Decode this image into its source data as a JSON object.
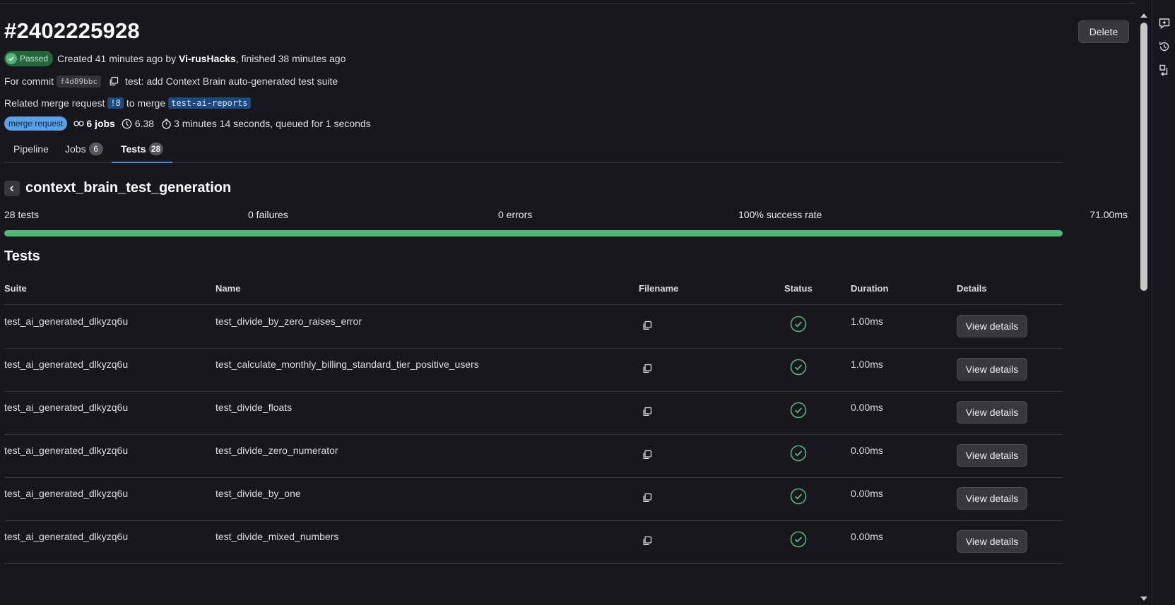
{
  "pipeline": {
    "title": "#2402225928",
    "delete_label": "Delete",
    "status_label": "Passed",
    "created_prefix": "Created 41 minutes ago by",
    "author": "Vi-rusHacks",
    "finished_text": ", finished 38 minutes ago",
    "commit_prefix": "For commit",
    "commit_sha": "f4d89bbc",
    "commit_message": "test: add Context Brain auto-generated test suite",
    "mr_prefix": "Related merge request",
    "mr_ref": "!8",
    "mr_to": "to merge",
    "branch": "test-ai-reports",
    "source_badge": "merge request",
    "jobs_count_label": "6 jobs",
    "score": "6.38",
    "duration_text": "3 minutes 14 seconds, queued for 1 seconds"
  },
  "tabs": [
    {
      "label": "Pipeline",
      "count": ""
    },
    {
      "label": "Jobs",
      "count": "6"
    },
    {
      "label": "Tests",
      "count": "28"
    }
  ],
  "suite": {
    "name": "context_brain_test_generation",
    "tests": "28 tests",
    "failures": "0 failures",
    "errors": "0 errors",
    "success_rate": "100% success rate",
    "duration": "71.00ms",
    "success_fraction": 1.0
  },
  "tests_section": {
    "heading": "Tests",
    "columns": [
      "Suite",
      "Name",
      "Filename",
      "Status",
      "Duration",
      "Details"
    ],
    "rows": [
      {
        "suite": "test_ai_generated_dlkyzq6u",
        "name": "test_divide_by_zero_raises_error",
        "status": "success",
        "duration": "1.00ms",
        "details_label": "View details"
      },
      {
        "suite": "test_ai_generated_dlkyzq6u",
        "name": "test_calculate_monthly_billing_standard_tier_positive_users",
        "status": "success",
        "duration": "1.00ms",
        "details_label": "View details"
      },
      {
        "suite": "test_ai_generated_dlkyzq6u",
        "name": "test_divide_floats",
        "status": "success",
        "duration": "0.00ms",
        "details_label": "View details"
      },
      {
        "suite": "test_ai_generated_dlkyzq6u",
        "name": "test_divide_zero_numerator",
        "status": "success",
        "duration": "0.00ms",
        "details_label": "View details"
      },
      {
        "suite": "test_ai_generated_dlkyzq6u",
        "name": "test_divide_by_one",
        "status": "success",
        "duration": "0.00ms",
        "details_label": "View details"
      },
      {
        "suite": "test_ai_generated_dlkyzq6u",
        "name": "test_divide_mixed_numbers",
        "status": "success",
        "duration": "0.00ms",
        "details_label": "View details"
      }
    ]
  },
  "colors": {
    "background": "#18171d",
    "success": "#52b87a",
    "link_bg": "#1f4a80",
    "tab_active": "#428fdc"
  },
  "icons": {
    "status": "check-circle-icon",
    "copy": "copy-icon",
    "back": "chevron-left-icon",
    "jobs": "pipeline-icon",
    "score": "gauge-icon",
    "duration": "timer-icon",
    "right_rail": [
      "comment-add-icon",
      "history-icon",
      "review-icon"
    ]
  }
}
